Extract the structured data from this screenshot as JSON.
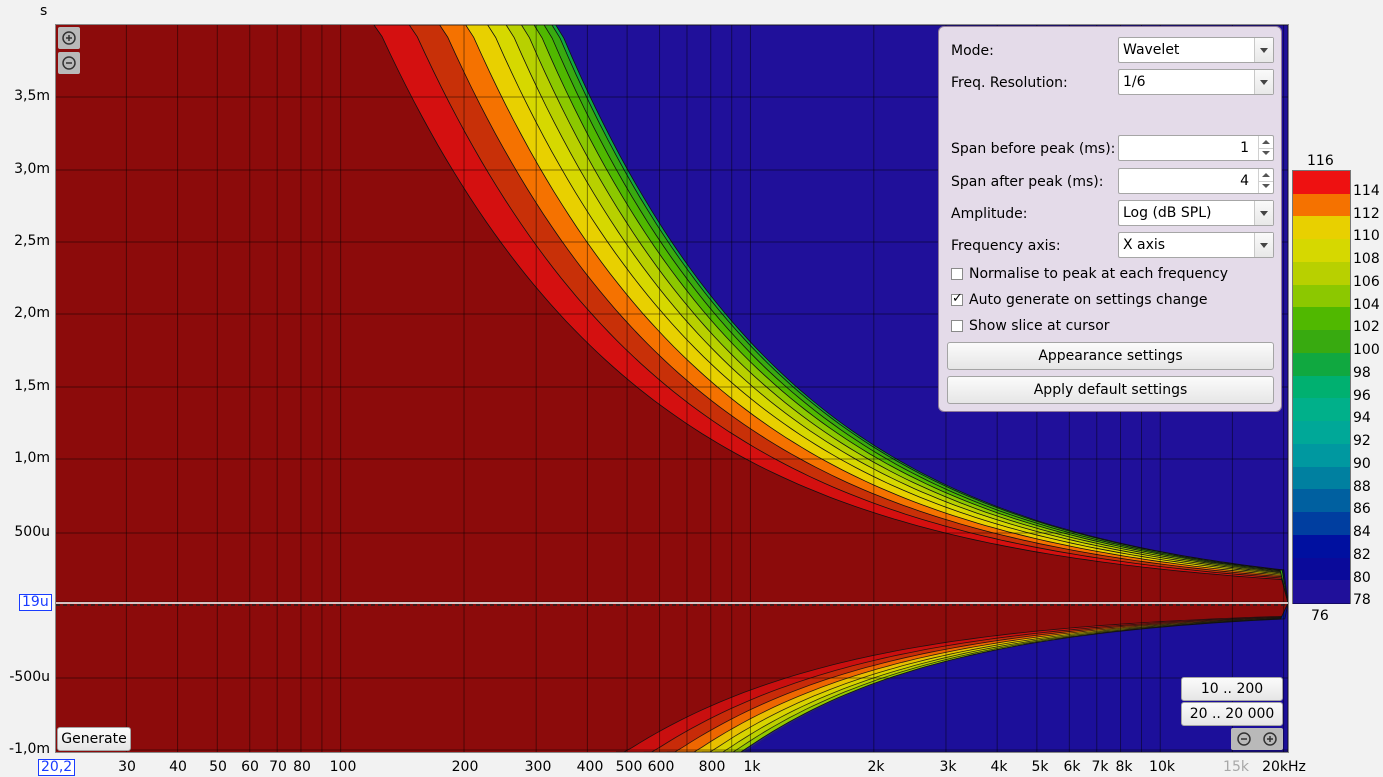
{
  "y_axis": {
    "unit": "s",
    "ticks": [
      "3,5m",
      "3,0m",
      "2,5m",
      "2,0m",
      "1,5m",
      "1,0m",
      "500u",
      "19u",
      "-500u",
      "-1,0m"
    ],
    "marker": "19u"
  },
  "x_axis": {
    "marker": "20,2",
    "ticks": [
      "30",
      "40",
      "50",
      "60",
      "70",
      "80",
      "100",
      "200",
      "300",
      "400",
      "500",
      "600",
      "800",
      "1k",
      "2k",
      "3k",
      "4k",
      "5k",
      "6k",
      "7k",
      "8k",
      "10k",
      "15k",
      "20kHz"
    ]
  },
  "plot": {
    "zoom_in_icon": "zoom-in-icon",
    "zoom_out_icon": "zoom-out-icon",
    "generate_label": "Generate",
    "range_buttons": [
      "10 .. 200",
      "20 .. 20 000"
    ]
  },
  "panel": {
    "mode_label": "Mode:",
    "mode_value": "Wavelet",
    "freq_res_label": "Freq. Resolution:",
    "freq_res_value": "1/6",
    "span_before_label": "Span before peak (ms):",
    "span_before_value": "1",
    "span_after_label": "Span after peak (ms):",
    "span_after_value": "4",
    "amplitude_label": "Amplitude:",
    "amplitude_value": "Log (dB SPL)",
    "freq_axis_label": "Frequency axis:",
    "freq_axis_value": "X axis",
    "normalise_label": "Normalise to peak at each frequency",
    "normalise_checked": false,
    "autogen_label": "Auto generate on settings change",
    "autogen_checked": true,
    "slice_label": "Show slice at cursor",
    "slice_checked": false,
    "appearance_button": "Appearance settings",
    "defaults_button": "Apply default settings"
  },
  "legend": {
    "max": "116",
    "min": "76",
    "labels": [
      "114",
      "112",
      "110",
      "108",
      "106",
      "104",
      "102",
      "100",
      "98",
      "96",
      "94",
      "92",
      "90",
      "88",
      "86",
      "84",
      "82",
      "80",
      "78"
    ],
    "colors": [
      "#ee1111",
      "#f57200",
      "#e8d000",
      "#d6d800",
      "#b8d000",
      "#8cc800",
      "#50b800",
      "#38aa10",
      "#10a840",
      "#00b070",
      "#00b08a",
      "#00a898",
      "#0098a0",
      "#0080a0",
      "#0060a0",
      "#003ea0",
      "#0010a0",
      "#0a0a9a",
      "#20109a"
    ]
  }
}
